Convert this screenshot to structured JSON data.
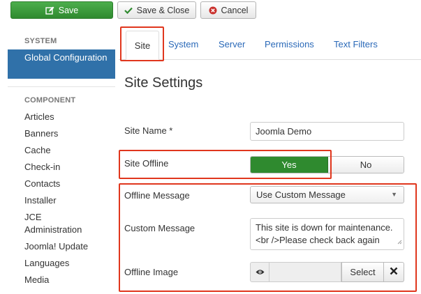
{
  "toolbar": {
    "save_label": "Save",
    "save_close_label": "Save & Close",
    "cancel_label": "Cancel"
  },
  "sidebar": {
    "section_system": "SYSTEM",
    "active_item": "Global Configuration",
    "section_component": "COMPONENT",
    "items": [
      "Articles",
      "Banners",
      "Cache",
      "Check-in",
      "Contacts",
      "Installer",
      "JCE Administration",
      "Joomla! Update",
      "Languages",
      "Media"
    ]
  },
  "tabs": {
    "site": "Site",
    "system": "System",
    "server": "Server",
    "permissions": "Permissions",
    "text_filters": "Text Filters"
  },
  "page_title": "Site Settings",
  "form": {
    "site_name_label": "Site Name *",
    "site_name_value": "Joomla Demo",
    "site_offline_label": "Site Offline",
    "yes_label": "Yes",
    "no_label": "No",
    "offline_message_label": "Offline Message",
    "offline_message_value": "Use Custom Message",
    "custom_message_label": "Custom Message",
    "custom_message_line1": "This site is down for maintenance.",
    "custom_message_line2": "<br />Please check back again",
    "offline_image_label": "Offline Image",
    "select_label": "Select"
  },
  "colors": {
    "primary_green": "#2f8a2f",
    "sidebar_active": "#3071a9",
    "tab_link": "#2a69b8",
    "highlight_red": "#e0361d"
  },
  "icons": {
    "save": "edit-icon",
    "save_close": "check-icon",
    "cancel": "close-circle-icon",
    "preview": "eye-icon",
    "clear": "close-icon"
  }
}
